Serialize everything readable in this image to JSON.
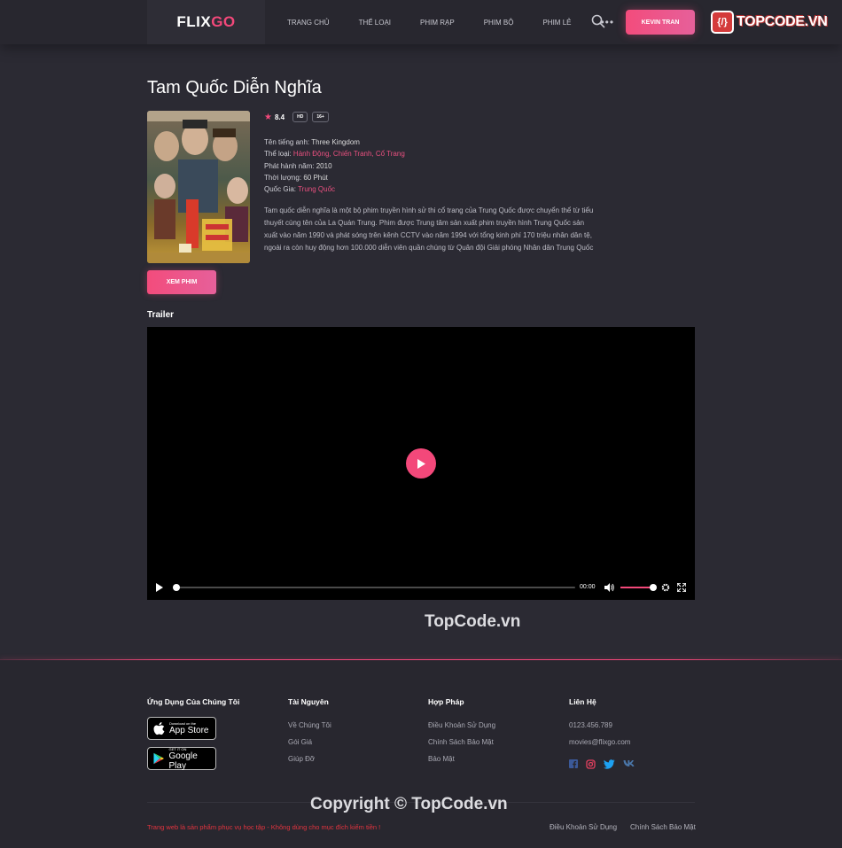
{
  "header": {
    "logo_part1": "FLIX",
    "logo_part2": "GO",
    "nav": [
      "TRANG CHỦ",
      "THỂ LOẠI",
      "PHIM RẠP",
      "PHIM BỘ",
      "PHIM LẺ"
    ],
    "more": "•••",
    "user_label": "KEVIN TRAN",
    "badge_icon": "{/}",
    "badge_text": "TOPCODE.VN"
  },
  "movie": {
    "title": "Tam Quốc Diễn Nghĩa",
    "rating": "8.4",
    "tags": [
      "HD",
      "16+"
    ],
    "info": [
      {
        "label": "Tên tiếng anh:",
        "value": "Three Kingdom",
        "link": false
      },
      {
        "label": "Thể loại:",
        "value": "Hành Động, Chiến Tranh, Cổ Trang",
        "link": true
      },
      {
        "label": "Phát hành năm:",
        "value": "2010",
        "link": false
      },
      {
        "label": "Thời lượng:",
        "value": "60 Phút",
        "link": false
      },
      {
        "label": "Quốc Gia:",
        "value": "Trung Quốc",
        "link": true
      }
    ],
    "description": "Tam quốc diễn nghĩa là một bộ phim truyền hình sử thi cổ trang của Trung Quốc được chuyển thể từ tiểu thuyết cùng tên của La Quán Trung. Phim được Trung tâm sản xuất phim truyền hình Trung Quốc sản xuất vào năm 1990 và phát sóng trên kênh CCTV vào năm 1994 với tổng kinh phí 170 triệu nhân dân tệ, ngoài ra còn huy động hơn 100.000 diễn viên quần chúng từ Quân đội Giải phóng Nhân dân Trung Quốc",
    "watch_label": "XEM PHIM"
  },
  "trailer": {
    "heading": "Trailer",
    "time": "00:00",
    "volume": 0.9
  },
  "watermark": {
    "middle": "TopCode.vn",
    "bottom": "Copyright © TopCode.vn"
  },
  "footer": {
    "apps": {
      "heading": "Ứng Dụng Của Chúng Tôi",
      "appstore_small": "Download on the",
      "appstore_big": "App Store",
      "gplay_small": "GET IT ON",
      "gplay_big": "Google Play"
    },
    "resources": {
      "heading": "Tài Nguyên",
      "links": [
        "Về Chúng Tôi",
        "Gói Giá",
        "Giúp Đỡ"
      ]
    },
    "legal": {
      "heading": "Hợp Pháp",
      "links": [
        "Điều Khoản Sử Dụng",
        "Chính Sách Bảo Mật",
        "Bảo Mật"
      ]
    },
    "contact": {
      "heading": "Liên Hệ",
      "phone": "0123.456.789",
      "email": "movies@flixgo.com"
    },
    "disclaimer": "Trang web là sản phẩm phục vụ học tập - Không dùng cho mục đích kiếm tiền !",
    "bottom_links": [
      "Điều Khoản Sử Dụng",
      "Chính Sách Bảo Mật"
    ]
  },
  "colors": {
    "accent": "#f3487a",
    "background": "#2b2a33",
    "header": "#28272f"
  }
}
